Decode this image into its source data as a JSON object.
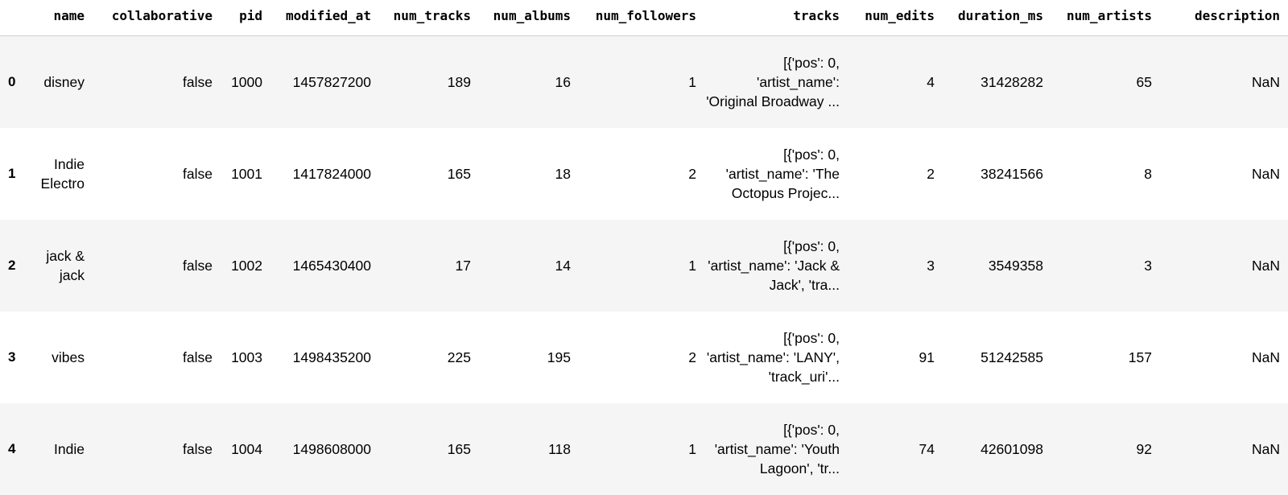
{
  "columns": [
    "name",
    "collaborative",
    "pid",
    "modified_at",
    "num_tracks",
    "num_albums",
    "num_followers",
    "tracks",
    "num_edits",
    "duration_ms",
    "num_artists",
    "description"
  ],
  "rows": [
    {
      "index": "0",
      "name": "disney",
      "collaborative": "false",
      "pid": "1000",
      "modified_at": "1457827200",
      "num_tracks": "189",
      "num_albums": "16",
      "num_followers": "1",
      "tracks": "[{'pos': 0, 'artist_name': 'Original Broadway ...",
      "num_edits": "4",
      "duration_ms": "31428282",
      "num_artists": "65",
      "description": "NaN"
    },
    {
      "index": "1",
      "name": "Indie Electro",
      "collaborative": "false",
      "pid": "1001",
      "modified_at": "1417824000",
      "num_tracks": "165",
      "num_albums": "18",
      "num_followers": "2",
      "tracks": "[{'pos': 0, 'artist_name': 'The Octopus Projec...",
      "num_edits": "2",
      "duration_ms": "38241566",
      "num_artists": "8",
      "description": "NaN"
    },
    {
      "index": "2",
      "name": "jack & jack",
      "collaborative": "false",
      "pid": "1002",
      "modified_at": "1465430400",
      "num_tracks": "17",
      "num_albums": "14",
      "num_followers": "1",
      "tracks": "[{'pos': 0, 'artist_name': 'Jack & Jack', 'tra...",
      "num_edits": "3",
      "duration_ms": "3549358",
      "num_artists": "3",
      "description": "NaN"
    },
    {
      "index": "3",
      "name": "vibes",
      "collaborative": "false",
      "pid": "1003",
      "modified_at": "1498435200",
      "num_tracks": "225",
      "num_albums": "195",
      "num_followers": "2",
      "tracks": "[{'pos': 0, 'artist_name': 'LANY', 'track_uri'...",
      "num_edits": "91",
      "duration_ms": "51242585",
      "num_artists": "157",
      "description": "NaN"
    },
    {
      "index": "4",
      "name": "Indie",
      "collaborative": "false",
      "pid": "1004",
      "modified_at": "1498608000",
      "num_tracks": "165",
      "num_albums": "118",
      "num_followers": "1",
      "tracks": "[{'pos': 0, 'artist_name': 'Youth Lagoon', 'tr...",
      "num_edits": "74",
      "duration_ms": "42601098",
      "num_artists": "92",
      "description": "NaN"
    }
  ]
}
